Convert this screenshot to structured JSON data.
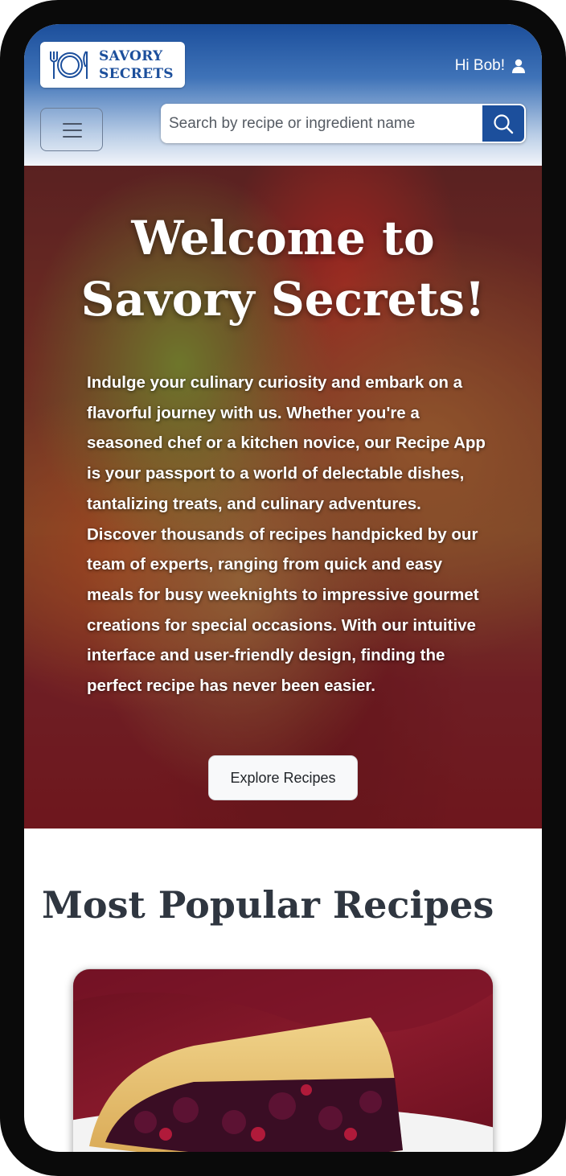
{
  "header": {
    "logo": {
      "line1": "SAVORY",
      "line2": "SECRETS",
      "icon": "plate-fork-knife-icon"
    },
    "greeting": "Hi Bob!",
    "user_icon": "user-icon",
    "menu_icon": "hamburger-icon",
    "search": {
      "placeholder": "Search by recipe or ingredient name",
      "value": "",
      "button_icon": "search-icon"
    }
  },
  "hero": {
    "title": "Welcome to Savory Secrets!",
    "description": "Indulge your culinary curiosity and embark on a flavorful journey with us. Whether you're a seasoned chef or a kitchen novice, our Recipe App is your passport to a world of delectable dishes, tantalizing treats, and culinary adventures. Discover thousands of recipes handpicked by our team of experts, ranging from quick and easy meals for busy weeknights to impressive gourmet creations for special occasions. With our intuitive interface and user-friendly design, finding the perfect recipe has never been easier.",
    "cta_label": "Explore Recipes"
  },
  "popular": {
    "title": "Most Popular Recipes"
  },
  "colors": {
    "brand_blue": "#1c4f9c",
    "heading_dark": "#2f3640",
    "button_light": "#f8f9fa"
  }
}
